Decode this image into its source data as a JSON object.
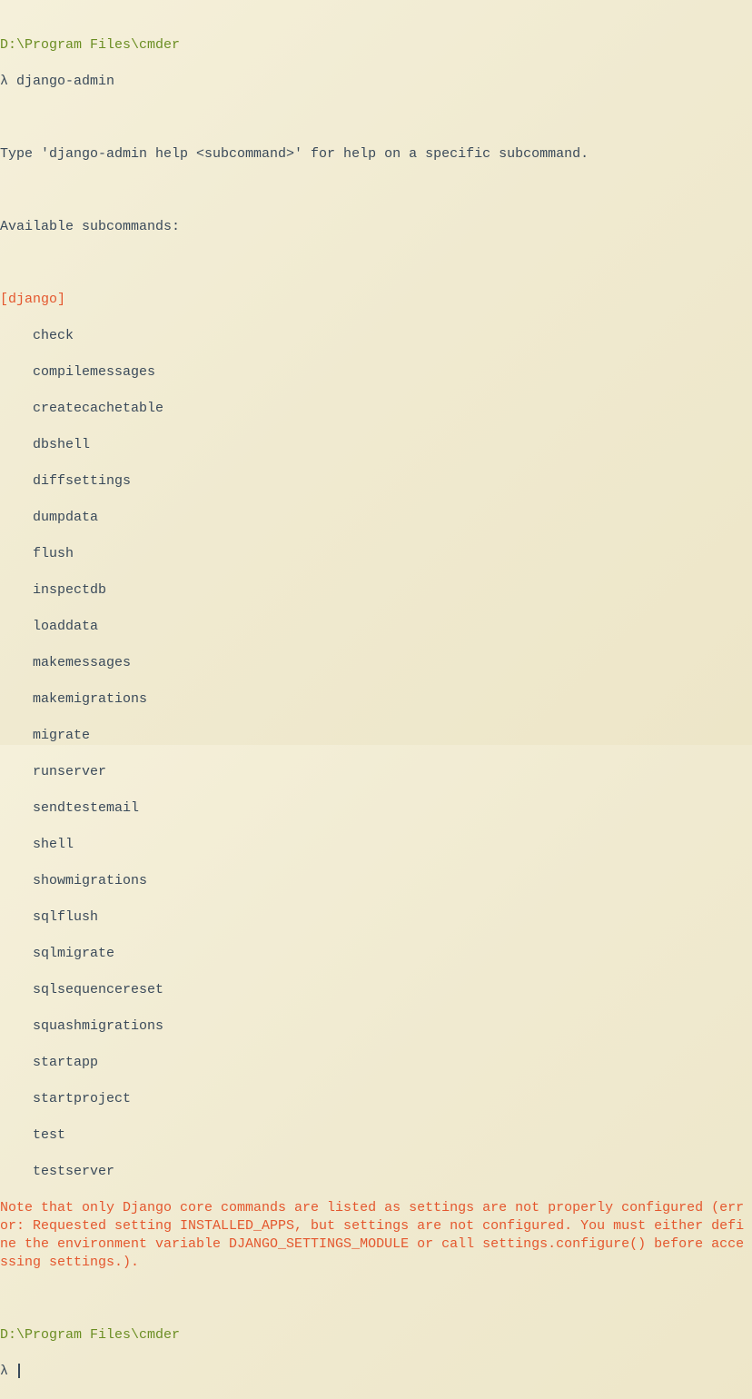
{
  "prompt1": {
    "path": "D:\\Program Files\\cmder",
    "symbol": "λ",
    "command": "django-admin"
  },
  "help_text": "Type 'django-admin help <subcommand>' for help on a specific subcommand.",
  "available_label": "Available subcommands:",
  "section": {
    "header": "[django]",
    "subcommands": [
      "check",
      "compilemessages",
      "createcachetable",
      "dbshell",
      "diffsettings",
      "dumpdata",
      "flush",
      "inspectdb",
      "loaddata",
      "makemessages",
      "makemigrations",
      "migrate",
      "runserver",
      "sendtestemail",
      "shell",
      "showmigrations",
      "sqlflush",
      "sqlmigrate",
      "sqlsequencereset",
      "squashmigrations",
      "startapp",
      "startproject",
      "test",
      "testserver"
    ]
  },
  "error_note": "Note that only Django core commands are listed as settings are not properly configured (error: Requested setting INSTALLED_APPS, but settings are not configured. You must either define the environment variable DJANGO_SETTINGS_MODULE or call settings.configure() before accessing settings.).",
  "prompt2": {
    "path": "D:\\Program Files\\cmder",
    "symbol": "λ"
  }
}
